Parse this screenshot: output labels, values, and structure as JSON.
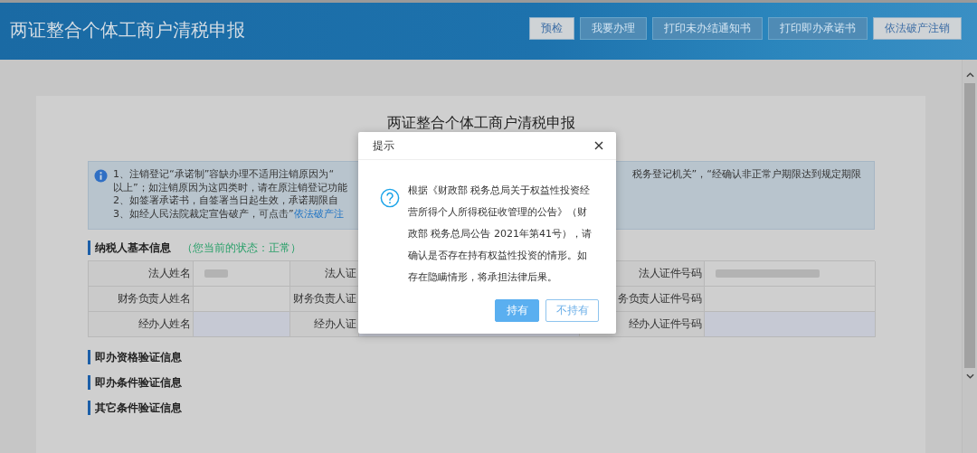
{
  "header": {
    "title": "两证整合个体工商户清税申报",
    "buttons": [
      {
        "label": "预检",
        "disabled": false
      },
      {
        "label": "我要办理",
        "disabled": true
      },
      {
        "label": "打印未办结通知书",
        "disabled": true
      },
      {
        "label": "打印即办承诺书",
        "disabled": true
      },
      {
        "label": "依法破产注销",
        "disabled": false
      }
    ]
  },
  "page": {
    "title": "两证整合个体工商户清税申报",
    "notice": {
      "lines": [
        {
          "text": "1、注销登记“承诺制”容缺办理不适用注销原因为“",
          "right": "税务登记机关”，“经确认非正常户期限达到规定期限"
        },
        {
          "text": "以上”；如注销原因为这四类时，请在原注销登记功能"
        },
        {
          "text": "2、如签署承诺书，自签署当日起生效，承诺期限自"
        },
        {
          "text": "3、如经人民法院裁定宣告破产，可点击”",
          "link": "依法破产注"
        }
      ]
    },
    "basic_info": {
      "heading": "纳税人基本信息",
      "status": "（您当前的状态：正常）",
      "rows": [
        {
          "cells": [
            {
              "kind": "label",
              "text": "法人姓名"
            },
            {
              "kind": "redacted"
            },
            {
              "kind": "label",
              "text": "法人证"
            },
            {
              "kind": "value"
            },
            {
              "kind": "label",
              "text": "法人证件号码"
            },
            {
              "kind": "redacted"
            }
          ]
        },
        {
          "cells": [
            {
              "kind": "label",
              "text": "财务负责人姓名"
            },
            {
              "kind": "value"
            },
            {
              "kind": "label",
              "text": "财务负责人证"
            },
            {
              "kind": "value"
            },
            {
              "kind": "label",
              "text": "务负责人证件号码"
            },
            {
              "kind": "value"
            }
          ]
        },
        {
          "cells": [
            {
              "kind": "label",
              "text": "经办人姓名"
            },
            {
              "kind": "input"
            },
            {
              "kind": "label",
              "text": "经办人证"
            },
            {
              "kind": "input"
            },
            {
              "kind": "label",
              "text": "经办人证件号码"
            },
            {
              "kind": "input"
            }
          ]
        }
      ]
    },
    "sections": [
      "即办资格验证信息",
      "即办条件验证信息",
      "其它条件验证信息"
    ]
  },
  "dialog": {
    "title": "提示",
    "message": "根据《财政部 税务总局关于权益性投资经营所得个人所得税征收管理的公告》（财政部 税务总局公告 2021年第41号），请确认是否存在持有权益性投资的情形。如存在隐瞒情形，将承担法律后果。",
    "buttons": [
      {
        "label": "持有",
        "kind": "primary"
      },
      {
        "label": "不持有",
        "kind": "default"
      }
    ]
  }
}
